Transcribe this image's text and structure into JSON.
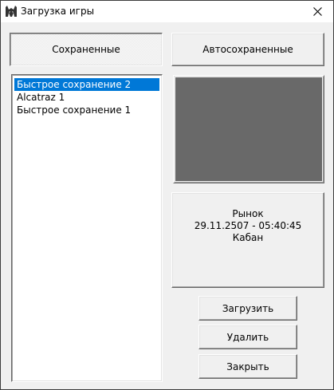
{
  "window": {
    "title": "Загрузка игры",
    "app_icon": "wolf-head-icon",
    "close_icon": "close-icon"
  },
  "tabs": {
    "saved_label": "Сохраненные",
    "auto_label": "Автосохраненные",
    "active": "saved"
  },
  "saves": {
    "items": [
      {
        "label": "Быстрое сохранение 2",
        "selected": true
      },
      {
        "label": "Alcatraz 1",
        "selected": false
      },
      {
        "label": "Быстрое сохранение 1",
        "selected": false
      }
    ]
  },
  "info": {
    "location": "Рынок",
    "datetime": "29.11.2507 - 05:40:45",
    "character": "Кабан"
  },
  "buttons": {
    "load": "Загрузить",
    "delete": "Удалить",
    "close": "Закрыть"
  },
  "colors": {
    "selection": "#0078d7",
    "preview_fill": "#696969",
    "face": "#f0f0f0"
  }
}
